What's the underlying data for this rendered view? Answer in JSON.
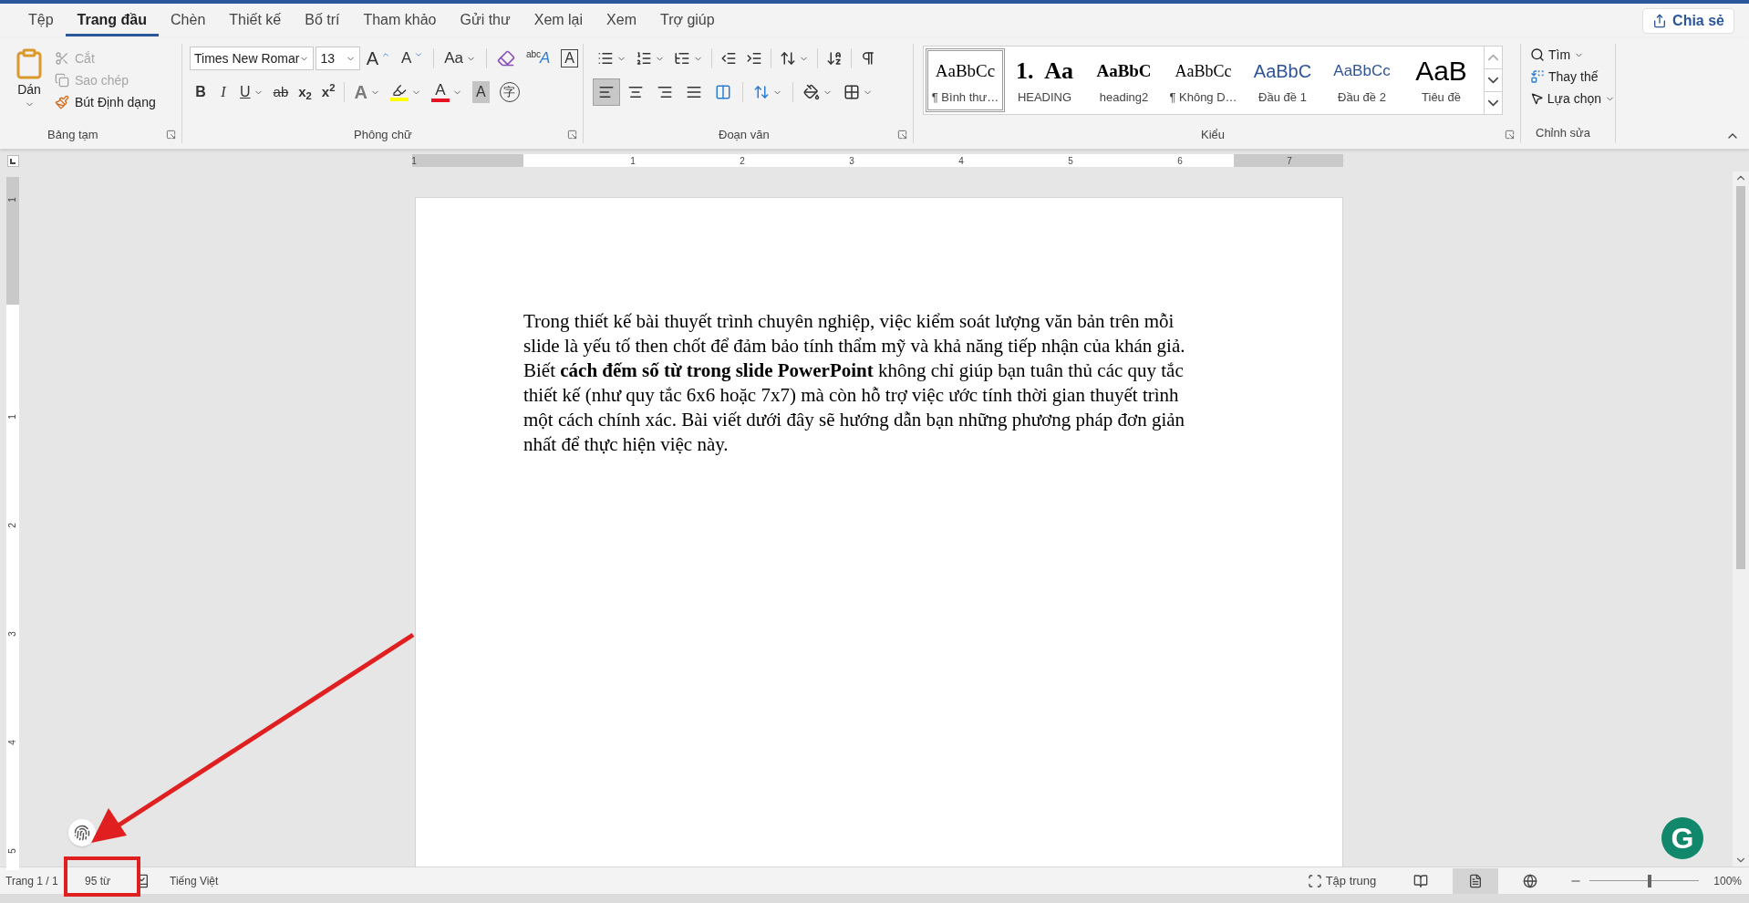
{
  "tabs": [
    {
      "label": "Tệp",
      "selected": false
    },
    {
      "label": "Trang đầu",
      "selected": true
    },
    {
      "label": "Chèn",
      "selected": false
    },
    {
      "label": "Thiết kế",
      "selected": false
    },
    {
      "label": "Bố trí",
      "selected": false
    },
    {
      "label": "Tham khảo",
      "selected": false
    },
    {
      "label": "Gửi thư",
      "selected": false
    },
    {
      "label": "Xem lại",
      "selected": false
    },
    {
      "label": "Xem",
      "selected": false
    },
    {
      "label": "Trợ giúp",
      "selected": false
    }
  ],
  "share_button": "Chia sẻ",
  "clipboard": {
    "title": "Bảng tạm",
    "paste": "Dán",
    "items": [
      {
        "label": "Cắt",
        "kind": "cut",
        "disabled": true
      },
      {
        "label": "Sao chép",
        "kind": "copy",
        "disabled": true
      },
      {
        "label": "Bút Định dạng",
        "kind": "painter",
        "disabled": false
      }
    ]
  },
  "font": {
    "title": "Phông chữ",
    "font_name": "Times New Romar",
    "font_size": "13",
    "row1_tools": [
      {
        "kind": "grow",
        "text": "A"
      },
      {
        "kind": "shrink",
        "text": "A"
      },
      {
        "kind": "case",
        "text": "Aa"
      },
      {
        "kind": "clear"
      },
      {
        "kind": "phonetic",
        "text": "abc",
        "mark": "A"
      },
      {
        "kind": "border",
        "text": "A"
      }
    ],
    "row2_tools": [
      {
        "kind": "bold",
        "text": "B"
      },
      {
        "kind": "italic",
        "text": "I"
      },
      {
        "kind": "underline",
        "text": "U"
      },
      {
        "kind": "strike",
        "text": "ab"
      },
      {
        "kind": "sub",
        "text": "x$_{2}$"
      },
      {
        "kind": "sup",
        "text": "x$^{2}$"
      },
      {
        "kind": "effects",
        "text": "A"
      },
      {
        "kind": "highlight",
        "color": "#ffff00"
      },
      {
        "kind": "font_color",
        "text": "A",
        "color": "#e81123"
      },
      {
        "kind": "shading",
        "text": "A"
      },
      {
        "kind": "enclose",
        "text": "字"
      }
    ]
  },
  "paragraph": {
    "title": "Đoạn văn",
    "alignments": [
      {
        "kind": "left",
        "selected": true
      },
      {
        "kind": "center",
        "selected": false
      },
      {
        "kind": "right",
        "selected": false
      },
      {
        "kind": "justify",
        "selected": false
      },
      {
        "kind": "distributed",
        "selected": false
      }
    ]
  },
  "styles": {
    "title": "Kiểu",
    "items": [
      {
        "preview": "AaBbCc",
        "label": "¶ Bình thư…",
        "kind": "normal",
        "selected": true
      },
      {
        "preview": "1.  Aa",
        "label": "HEADING",
        "kind": "heading",
        "selected": false
      },
      {
        "preview": "AaBbC",
        "label": "heading2",
        "kind": "heading2",
        "selected": false
      },
      {
        "preview": "AaBbCc",
        "label": "¶ Không D…",
        "kind": "nospacing",
        "selected": false
      },
      {
        "preview": "AaBbC",
        "label": "Đầu đề 1",
        "kind": "h1",
        "selected": false
      },
      {
        "preview": "AaBbCc",
        "label": "Đầu đề 2",
        "kind": "h2",
        "selected": false
      },
      {
        "preview": "AaB",
        "label": "Tiêu đề",
        "kind": "title",
        "selected": false
      }
    ]
  },
  "editing": {
    "title": "Chỉnh sửa",
    "items": [
      {
        "label": "Tìm",
        "kind": "find"
      },
      {
        "label": "Thay thế",
        "kind": "replace"
      },
      {
        "label": "Lựa chọn",
        "kind": "select"
      }
    ]
  },
  "ruler": {
    "horizontal": [
      "1",
      "1",
      "2",
      "3",
      "4",
      "5",
      "6",
      "7"
    ],
    "vertical": [
      "1",
      "1",
      "2",
      "3",
      "4",
      "5"
    ]
  },
  "document": {
    "paragraph": "Trong thiết kế bài thuyết trình chuyên nghiệp, việc kiểm soát lượng văn bản trên mỗi slide là yếu tố then chốt để đảm bảo tính thẩm mỹ và khả năng tiếp nhận của khán giả. Biết **cách đếm số từ trong slide PowerPoint** không chỉ giúp bạn tuân thủ các quy tắc thiết kế (như quy tắc 6x6 hoặc 7x7) mà còn hỗ trợ việc ước tính thời gian thuyết trình một cách chính xác. Bài viết dưới đây sẽ hướng dẫn bạn những phương pháp đơn giản nhất để thực hiện việc này."
  },
  "status_bar": {
    "page": "Trang 1 / 1",
    "words": "95 từ",
    "language": "Tiếng Việt",
    "focus": "Tập trung",
    "views": [
      {
        "kind": "read",
        "selected": false
      },
      {
        "kind": "print",
        "selected": true
      },
      {
        "kind": "web",
        "selected": false
      }
    ],
    "zoom": {
      "level": 0.55,
      "reading": "100%"
    }
  },
  "floating_badge": "G"
}
